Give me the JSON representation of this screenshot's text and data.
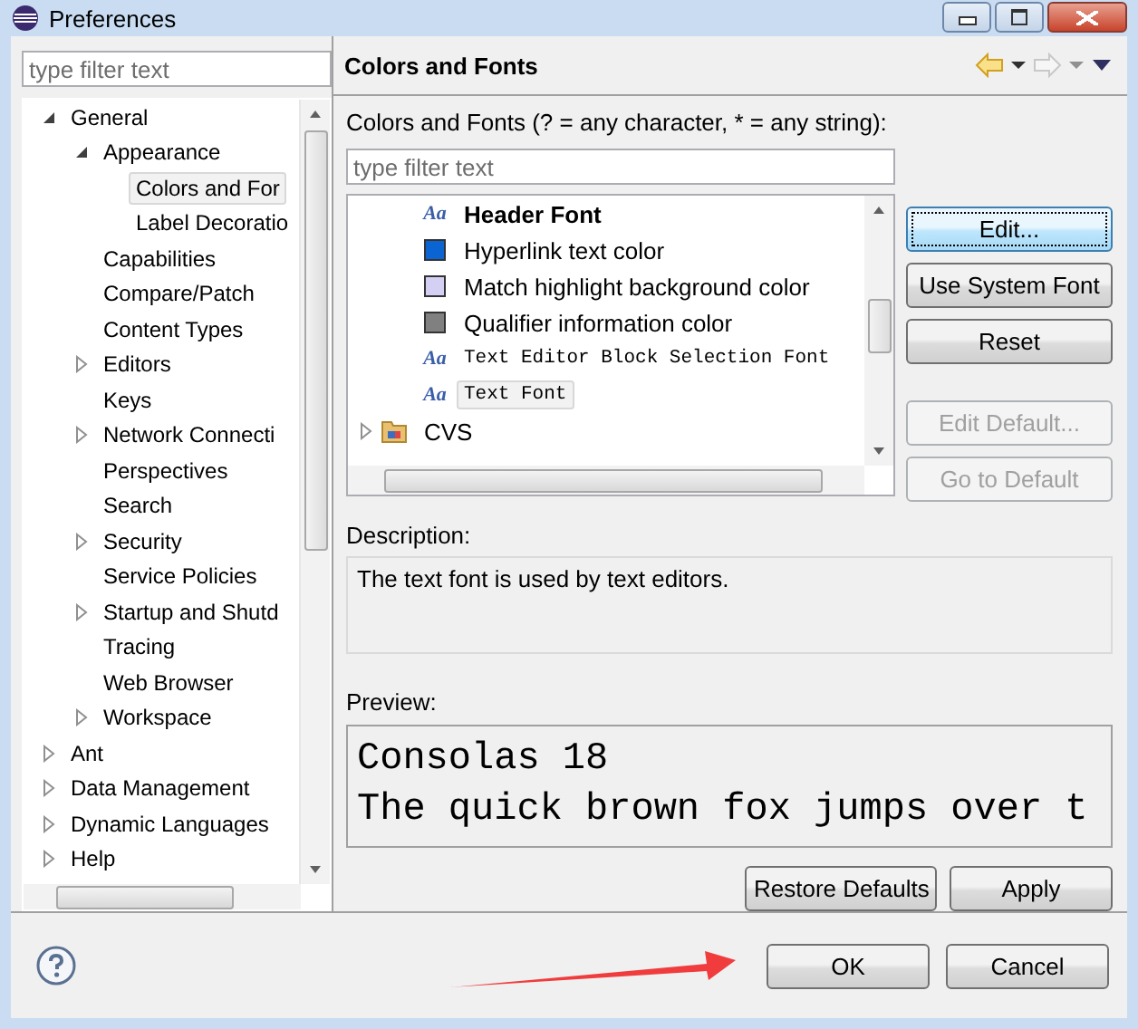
{
  "window": {
    "title": "Preferences"
  },
  "sidebar": {
    "filter": {
      "placeholder": "type filter text"
    },
    "tree": [
      {
        "label": "General",
        "expandable": true,
        "expanded": true,
        "selected": false,
        "children": [
          {
            "label": "Appearance",
            "expandable": true,
            "expanded": true,
            "selected": false,
            "children": [
              {
                "label": "Colors and For",
                "expandable": false,
                "selected": true
              },
              {
                "label": "Label Decoratio",
                "expandable": false,
                "selected": false
              }
            ]
          },
          {
            "label": "Capabilities",
            "expandable": false,
            "selected": false
          },
          {
            "label": "Compare/Patch",
            "expandable": false,
            "selected": false
          },
          {
            "label": "Content Types",
            "expandable": false,
            "selected": false
          },
          {
            "label": "Editors",
            "expandable": true,
            "expanded": false,
            "selected": false
          },
          {
            "label": "Keys",
            "expandable": false,
            "selected": false
          },
          {
            "label": "Network Connecti",
            "expandable": true,
            "expanded": false,
            "selected": false
          },
          {
            "label": "Perspectives",
            "expandable": false,
            "selected": false
          },
          {
            "label": "Search",
            "expandable": false,
            "selected": false
          },
          {
            "label": "Security",
            "expandable": true,
            "expanded": false,
            "selected": false
          },
          {
            "label": "Service Policies",
            "expandable": false,
            "selected": false
          },
          {
            "label": "Startup and Shutd",
            "expandable": true,
            "expanded": false,
            "selected": false
          },
          {
            "label": "Tracing",
            "expandable": false,
            "selected": false
          },
          {
            "label": "Web Browser",
            "expandable": false,
            "selected": false
          },
          {
            "label": "Workspace",
            "expandable": true,
            "expanded": false,
            "selected": false
          }
        ]
      },
      {
        "label": "Ant",
        "expandable": true,
        "expanded": false,
        "selected": false
      },
      {
        "label": "Data Management",
        "expandable": true,
        "expanded": false,
        "selected": false
      },
      {
        "label": "Dynamic Languages",
        "expandable": true,
        "expanded": false,
        "selected": false
      },
      {
        "label": "Help",
        "expandable": true,
        "expanded": false,
        "selected": false
      }
    ]
  },
  "page": {
    "title": "Colors and Fonts",
    "filter_label": "Colors and Fonts (? = any character, * = any string):",
    "filter": {
      "placeholder": "type filter text"
    },
    "items": [
      {
        "kind": "ui_font",
        "icon_text": "Aa",
        "label": "Header Font",
        "selected": false
      },
      {
        "kind": "color",
        "label": "Hyperlink text color",
        "color": "#0a64d2",
        "selected": false
      },
      {
        "kind": "color",
        "label": "Match highlight background color",
        "color": "#d4d0f4",
        "selected": false
      },
      {
        "kind": "color",
        "label": "Qualifier information color",
        "color": "#808080",
        "selected": false
      },
      {
        "kind": "editor_font",
        "icon_text": "Aa",
        "label": "Text Editor Block Selection Font",
        "selected": false
      },
      {
        "kind": "editor_font",
        "icon_text": "Aa",
        "label": "Text Font",
        "selected": true
      },
      {
        "kind": "folder",
        "label": "CVS",
        "selected": false
      }
    ],
    "buttons": [
      {
        "label": "Edit...",
        "disabled": false,
        "focused": true
      },
      {
        "label": "Use System Font",
        "disabled": false,
        "focused": false
      },
      {
        "label": "Reset",
        "disabled": false,
        "focused": false
      },
      {
        "label": "Edit Default...",
        "disabled": true,
        "focused": false
      },
      {
        "label": "Go to Default",
        "disabled": true,
        "focused": false
      }
    ],
    "description_label": "Description:",
    "description": "The text font is used by text editors.",
    "preview_label": "Preview:",
    "preview": [
      "Consolas 18",
      "The quick brown fox jumps over t"
    ],
    "actions": [
      "Restore Defaults",
      "Apply"
    ]
  },
  "footer": {
    "buttons": [
      "OK",
      "Cancel"
    ]
  }
}
